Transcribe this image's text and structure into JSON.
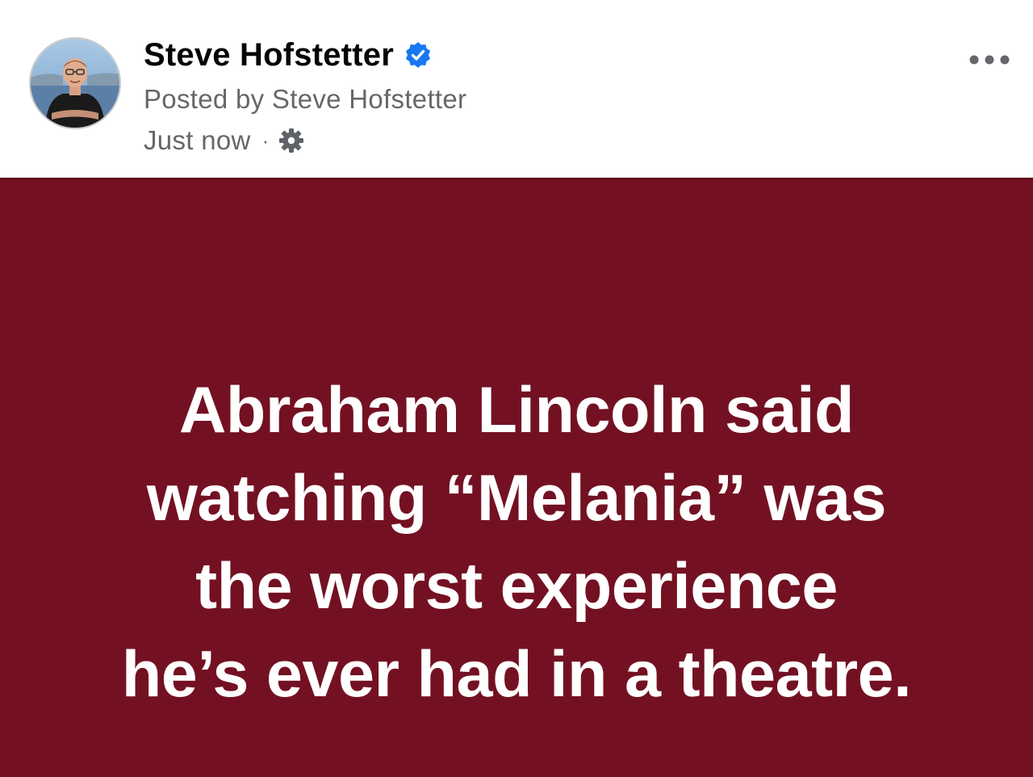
{
  "post": {
    "author": {
      "name": "Steve Hofstetter",
      "verified": true,
      "avatar_icon": "profile-photo"
    },
    "posted_by": "Posted by Steve Hofstetter",
    "timestamp": "Just now",
    "separator": "·",
    "audience_icon": "gear-icon",
    "more_icon": "ellipsis-icon",
    "body": {
      "background_color": "#731123",
      "text_color": "#ffffff",
      "lines": [
        "Abraham Lincoln said",
        "watching “Melania” was",
        "the worst experience",
        "he’s ever had in a theatre."
      ]
    }
  },
  "colors": {
    "verified_badge": "#1877f2",
    "meta_text": "#65676b"
  }
}
